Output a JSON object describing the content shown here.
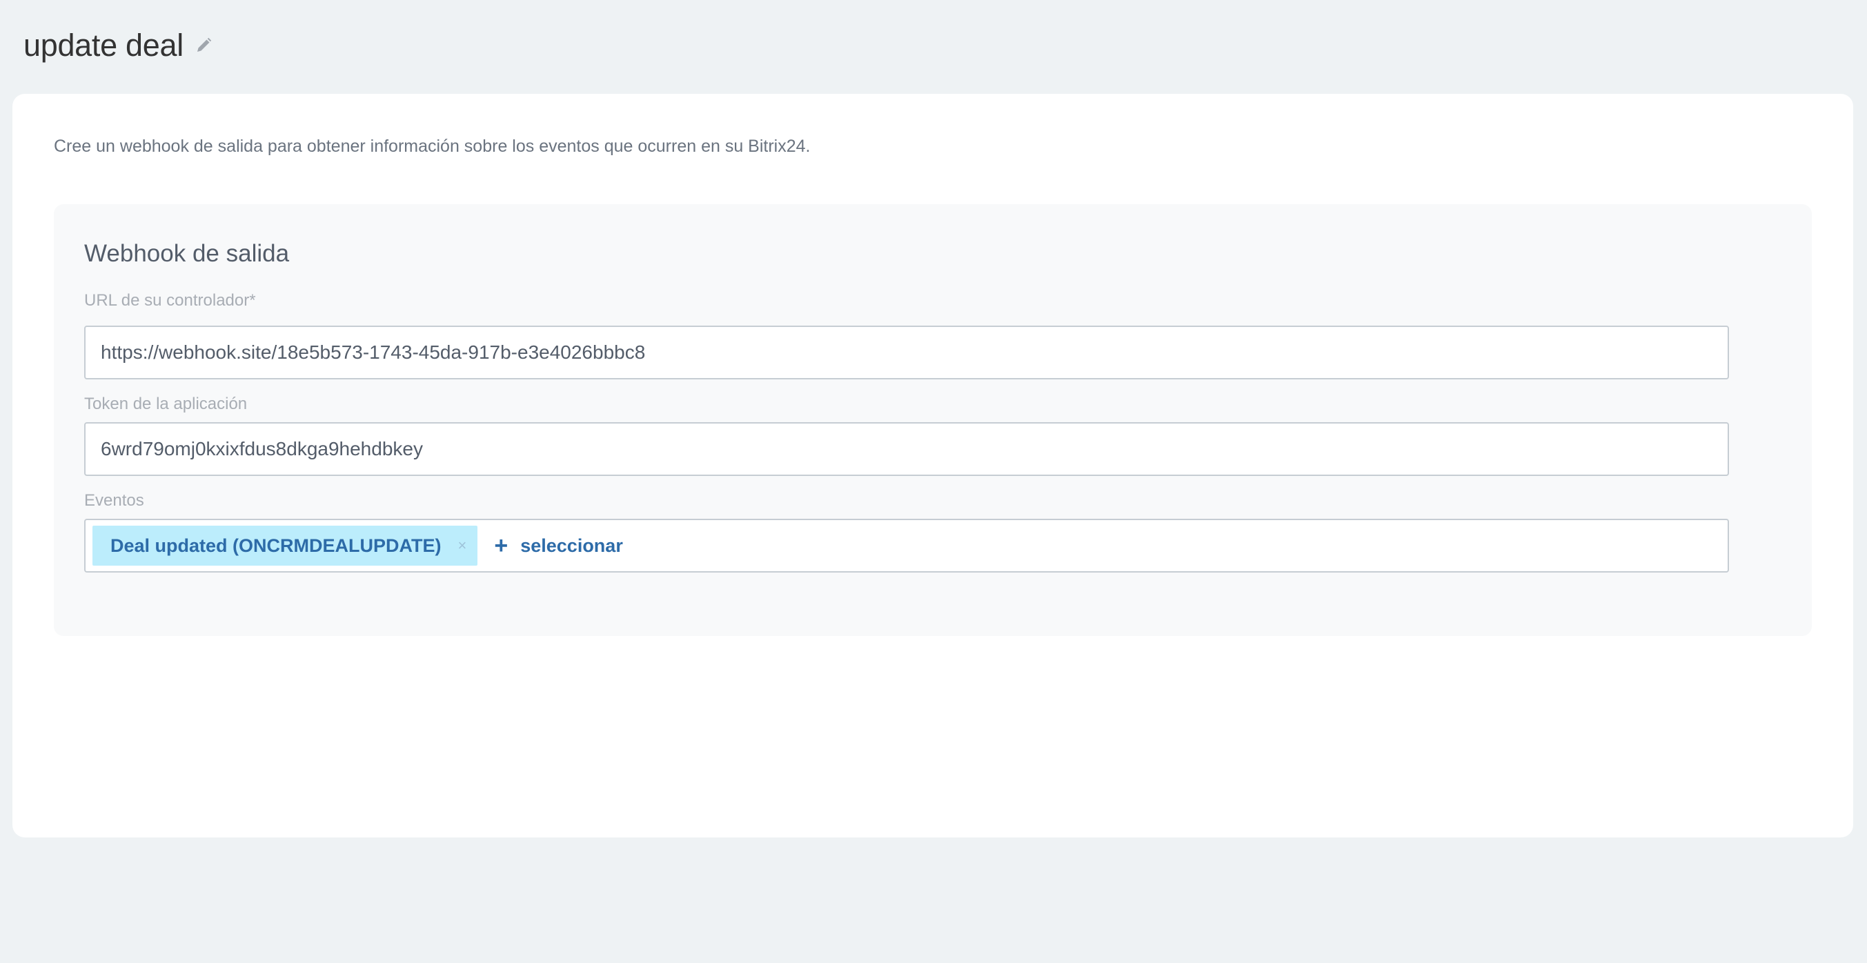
{
  "header": {
    "title": "update deal"
  },
  "card": {
    "description": "Cree un webhook de salida para obtener información sobre los eventos que ocurren en su Bitrix24."
  },
  "webhook": {
    "title": "Webhook de salida",
    "url_label": "URL de su controlador*",
    "url_value": "https://webhook.site/18e5b573-1743-45da-917b-e3e4026bbbc8",
    "token_label": "Token de la aplicación",
    "token_value": "6wrd79omj0kxixfdus8dkga9hehdbkey",
    "events_label": "Eventos",
    "events": [
      {
        "label": "Deal updated (ONCRMDEALUPDATE)"
      }
    ],
    "remove_glyph": "×",
    "add_glyph": "+",
    "add_label": "seleccionar"
  },
  "colors": {
    "accent": "#2d6ba8",
    "tag_bg": "#bcedfc",
    "page_bg": "#eef2f4"
  },
  "icons": {
    "edit": "pencil-icon",
    "remove": "close-icon",
    "add": "plus-icon"
  }
}
